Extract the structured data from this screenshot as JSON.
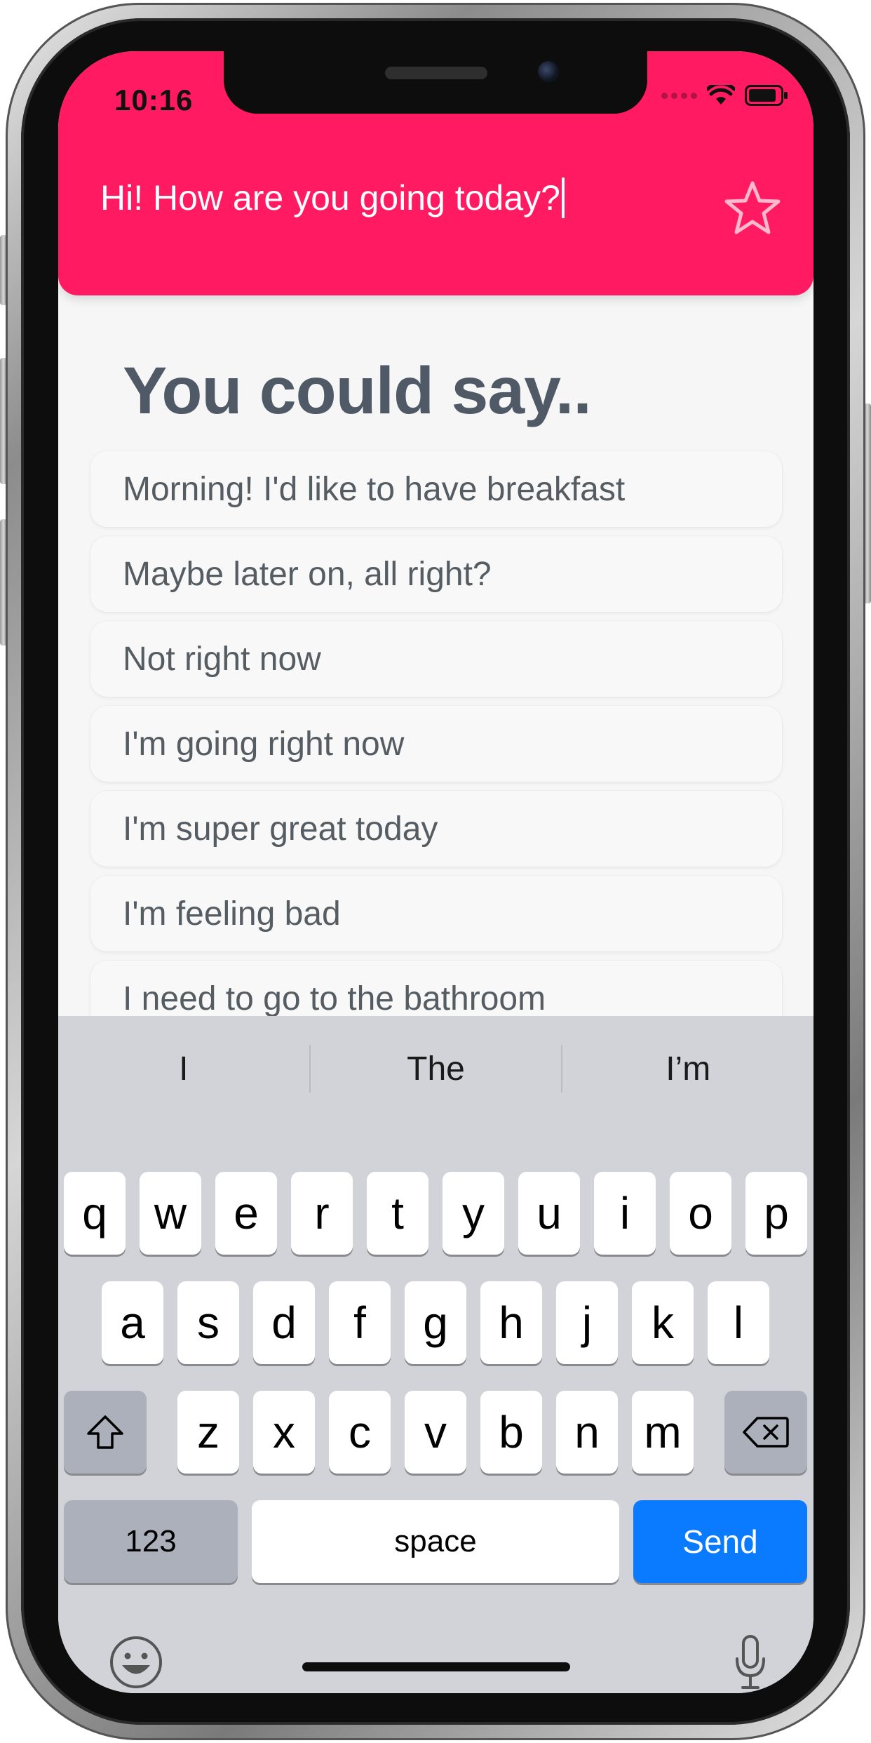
{
  "status_bar": {
    "time": "10:16"
  },
  "header": {
    "query_text": "Hi! How are you going today?",
    "colors": {
      "accent": "#ff1a62"
    }
  },
  "main": {
    "heading": "You could say..",
    "suggestions": [
      "Morning! I'd like to have breakfast",
      "Maybe later on, all right?",
      "Not right now",
      "I'm going right now",
      "I'm super great today",
      "I'm feeling bad",
      "I need to go to the bathroom"
    ]
  },
  "keyboard": {
    "predictions": [
      "I",
      "The",
      "I’m"
    ],
    "row1": [
      "q",
      "w",
      "e",
      "r",
      "t",
      "y",
      "u",
      "i",
      "o",
      "p"
    ],
    "row2": [
      "a",
      "s",
      "d",
      "f",
      "g",
      "h",
      "j",
      "k",
      "l"
    ],
    "row3": [
      "z",
      "x",
      "c",
      "v",
      "b",
      "n",
      "m"
    ],
    "numbers_label": "123",
    "space_label": "space",
    "send_label": "Send",
    "icons": [
      "shift-icon",
      "backspace-icon",
      "emoji-icon",
      "microphone-icon"
    ],
    "colors": {
      "send": "#0a7aff"
    }
  }
}
